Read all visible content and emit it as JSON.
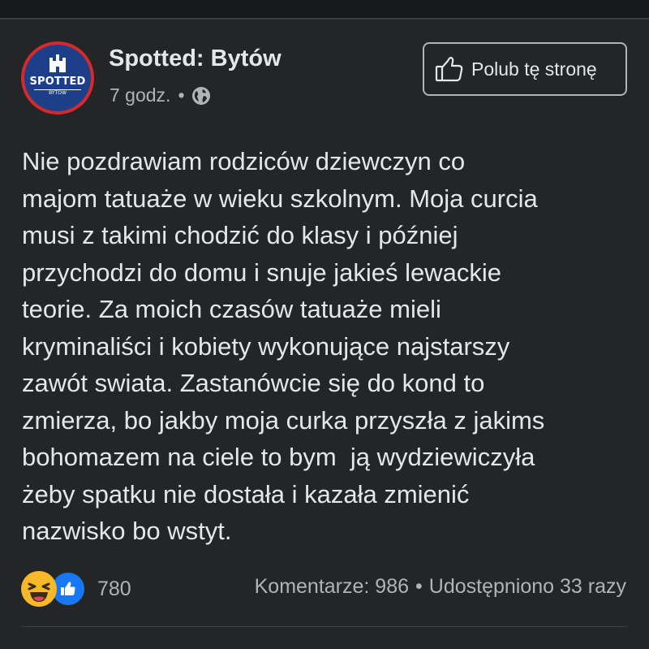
{
  "post": {
    "page_name": "Spotted: Bytów",
    "time": "7 godz.",
    "separator_dot": "•",
    "avatar_text": "SPOTTED",
    "avatar_subtext": "BYTÓW",
    "privacy_icon": "globe-icon",
    "like_page_label": "Polub tę stronę",
    "like_page_icon": "thumbs-up-outline-icon",
    "text": "Nie pozdrawiam rodziców dziewczyn co\nmajom tatuaże w wieku szkolnym. Moja curcia\nmusi z takimi chodzić do klasy i później\nprzychodzi do domu i snuje jakieś lewackie\nteorie. Za moich czasów tatuaże mieli\nkryminaliści i kobiety wykonujące najstarszy\nzawót swiata. Zastanówcie się do kond to\nzmierza, bo jakby moja curka przyszła z jakims\nbohomazem na ciele to bym  ją wydziewiczyła\nżeby spatku nie dostała i kazała zmienić\nnazwisko bo wstyt."
  },
  "reactions": {
    "icons": [
      "haha-icon",
      "like-icon"
    ],
    "count": "780"
  },
  "stats": {
    "comments": "Komentarze: 986",
    "separator": "•",
    "shares": "Udostępniono 33 razy"
  },
  "colors": {
    "background": "#18191a",
    "card": "#242526",
    "text_primary": "#e4e6eb",
    "text_secondary": "#b0b3b8",
    "like_blue": "#1877f2",
    "haha_yellow": "#f7b928",
    "avatar_red": "#d42a2a",
    "avatar_blue": "#1d3f8a"
  }
}
